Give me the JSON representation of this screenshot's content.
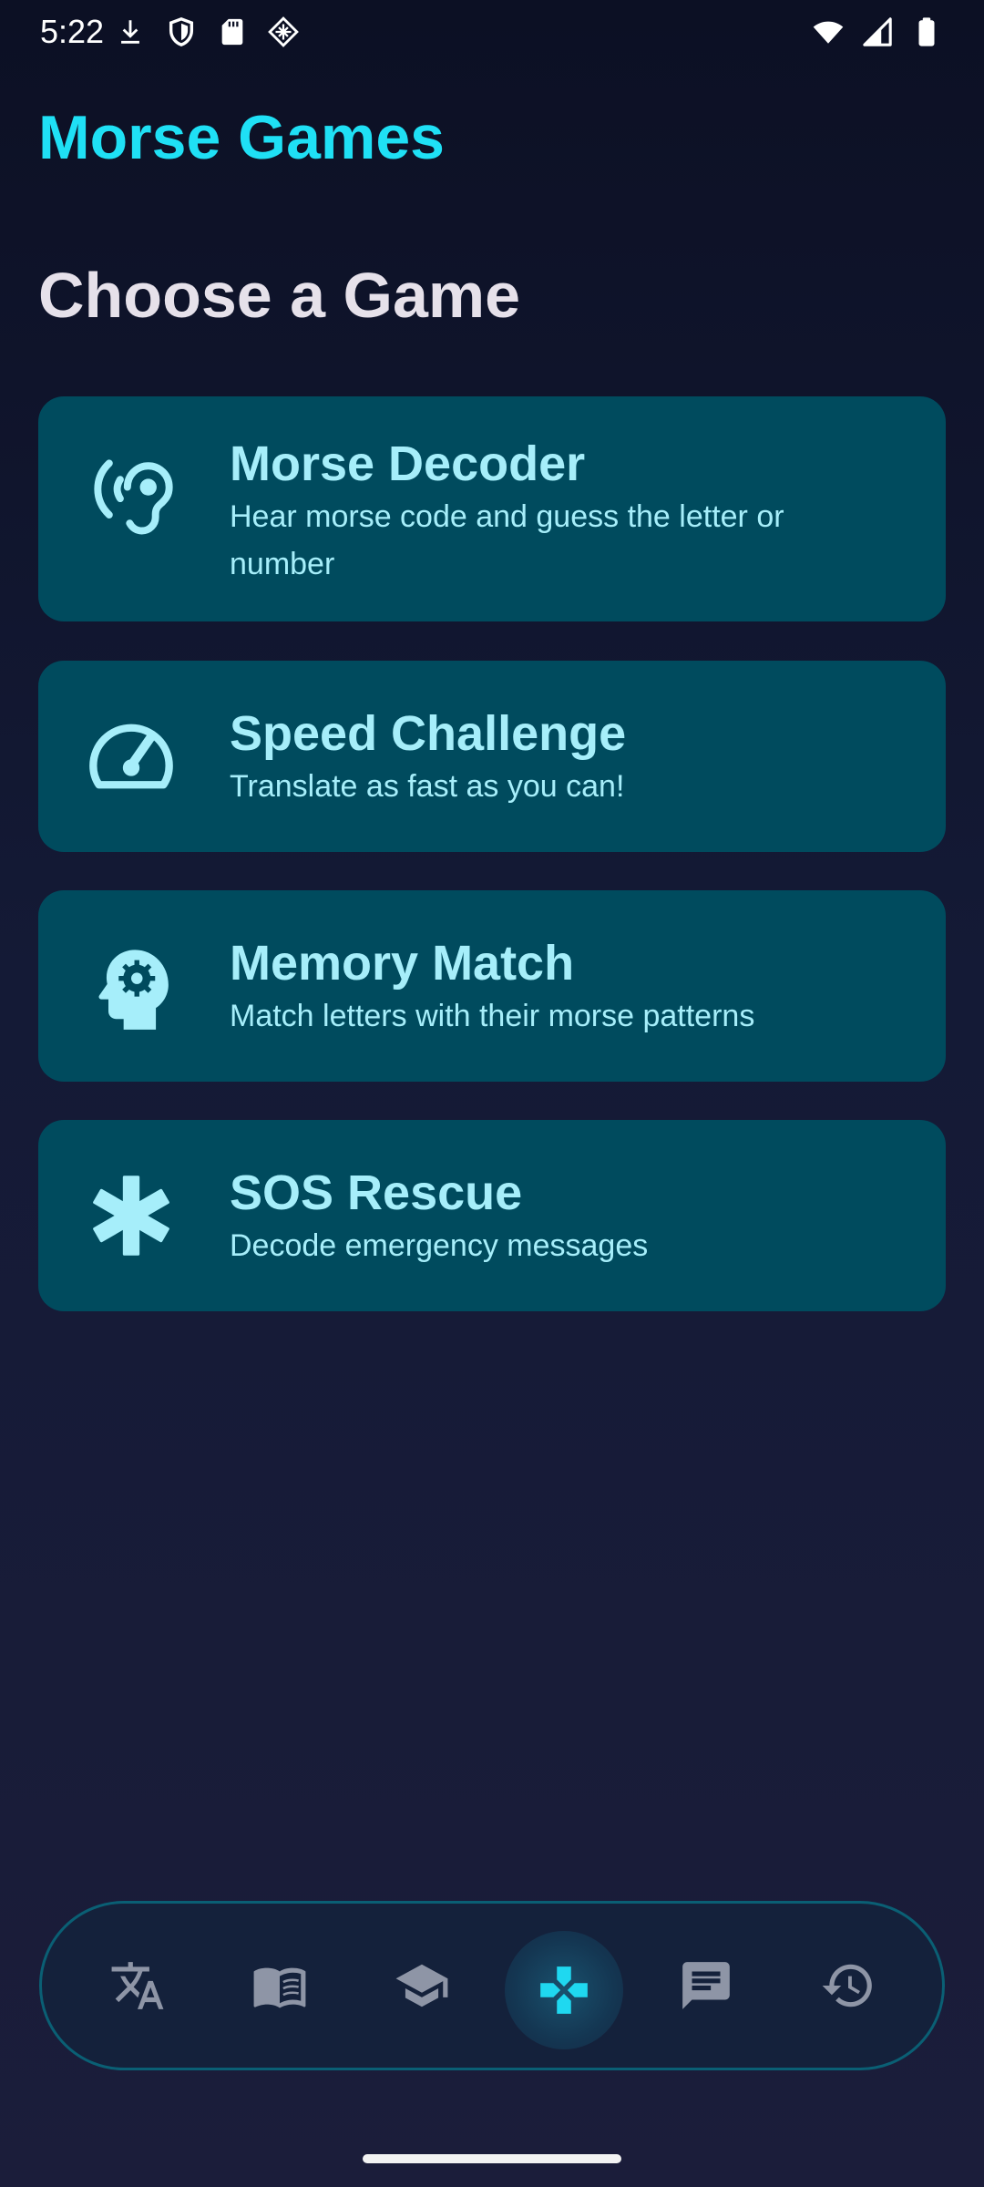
{
  "status_bar": {
    "time": "5:22",
    "left_icons": [
      "download-icon",
      "shield-icon",
      "sd-card-icon",
      "diamond-grid-icon"
    ],
    "right_icons": [
      "wifi-icon",
      "cellular-signal-icon",
      "battery-icon"
    ]
  },
  "header": {
    "title": "Morse Games"
  },
  "section": {
    "heading": "Choose a Game"
  },
  "games": [
    {
      "title": "Morse Decoder",
      "description": "Hear morse code and guess the letter or number",
      "icon": "ear-icon"
    },
    {
      "title": "Speed Challenge",
      "description": "Translate as fast as you can!",
      "icon": "speedometer-icon"
    },
    {
      "title": "Memory Match",
      "description": "Match letters with their morse patterns",
      "icon": "brain-gear-icon"
    },
    {
      "title": "SOS Rescue",
      "description": "Decode emergency messages",
      "icon": "asterisk-icon"
    }
  ],
  "bottom_nav": {
    "items": [
      {
        "icon": "translate-icon",
        "active": false
      },
      {
        "icon": "book-icon",
        "active": false
      },
      {
        "icon": "school-icon",
        "active": false
      },
      {
        "icon": "gamepad-icon",
        "active": true
      },
      {
        "icon": "chat-icon",
        "active": false
      },
      {
        "icon": "history-icon",
        "active": false
      }
    ]
  },
  "colors": {
    "accent": "#1fe0f5",
    "card_background": "#004b5e",
    "card_text": "#a6eefa",
    "nav_icon": "#8e95a6",
    "background": "#141a36"
  }
}
